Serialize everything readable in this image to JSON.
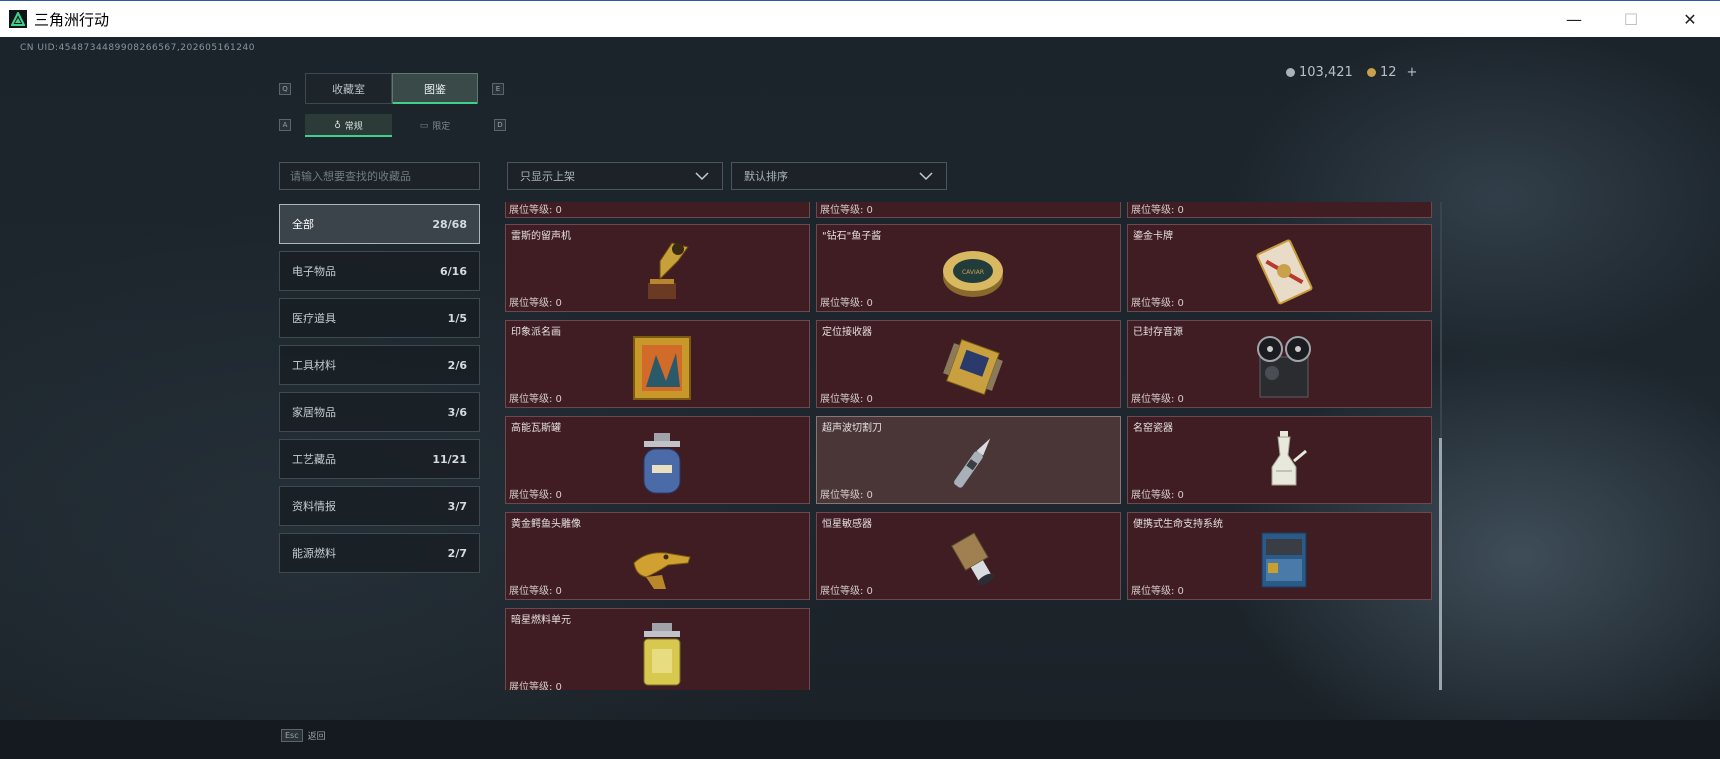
{
  "window": {
    "title": "三角洲行动",
    "minimize": "—",
    "maximize": "☐",
    "close": "✕"
  },
  "uid": "CN UID:4548734489908266567,202605161240",
  "currency": {
    "silver": "103,421",
    "gold": "12",
    "gold_add": "+"
  },
  "tabs": {
    "key_left": "Q",
    "key_right": "E",
    "collection_room": "收藏室",
    "catalog": "图鉴",
    "sub_key_left": "A",
    "sub_key_right": "D",
    "sub_regular": "常规",
    "sub_limited": "限定"
  },
  "search": {
    "placeholder": "请输入想要查找的收藏品"
  },
  "filters": {
    "shelf": "只显示上架",
    "sort": "默认排序"
  },
  "categories": [
    {
      "label": "全部",
      "count": "28/68"
    },
    {
      "label": "电子物品",
      "count": "6/16"
    },
    {
      "label": "医疗道具",
      "count": "1/5"
    },
    {
      "label": "工具材料",
      "count": "2/6"
    },
    {
      "label": "家居物品",
      "count": "3/6"
    },
    {
      "label": "工艺藏品",
      "count": "11/21"
    },
    {
      "label": "资料情报",
      "count": "3/7"
    },
    {
      "label": "能源燃料",
      "count": "2/7"
    }
  ],
  "level_label": "展位等级: 0",
  "items": [
    {
      "name": "雷斯的留声机",
      "icon": "gramophone-icon"
    },
    {
      "name": "\"钻石\"鱼子酱",
      "icon": "caviar-tin-icon"
    },
    {
      "name": "鎏金卡牌",
      "icon": "gilded-card-icon"
    },
    {
      "name": "印象派名画",
      "icon": "painting-icon"
    },
    {
      "name": "定位接收器",
      "icon": "receiver-icon"
    },
    {
      "name": "已封存音源",
      "icon": "reel-recorder-icon"
    },
    {
      "name": "高能瓦斯罐",
      "icon": "gas-canister-icon"
    },
    {
      "name": "超声波切割刀",
      "icon": "ultrasonic-knife-icon"
    },
    {
      "name": "名窑瓷器",
      "icon": "porcelain-vase-icon"
    },
    {
      "name": "黄金鳄鱼头雕像",
      "icon": "golden-crocodile-icon"
    },
    {
      "name": "恒星敏感器",
      "icon": "star-sensor-icon"
    },
    {
      "name": "便携式生命支持系统",
      "icon": "life-support-icon"
    },
    {
      "name": "暗星燃料单元",
      "icon": "fuel-cell-icon"
    }
  ],
  "esc": {
    "key": "Esc",
    "label": "返回"
  },
  "colors": {
    "accent": "#3fd08c",
    "card_bg": "#3f1d22",
    "card_border": "#6a4a4e"
  }
}
